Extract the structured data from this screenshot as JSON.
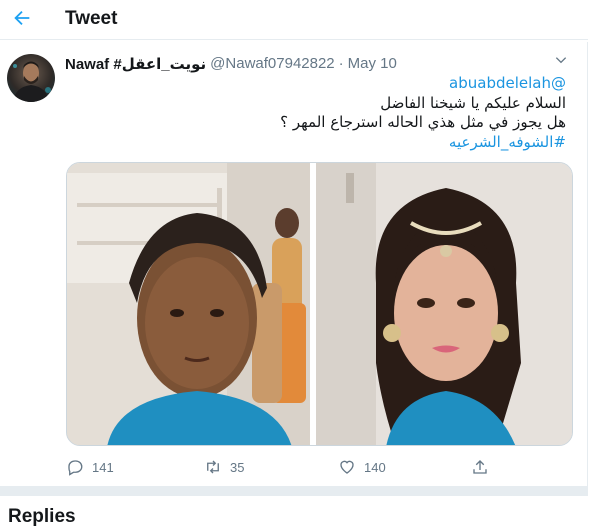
{
  "header": {
    "title": "Tweet"
  },
  "tweet": {
    "user_name": "Nawaf #نويت_اعقل",
    "handle": "@Nawaf07942822",
    "separator": "·",
    "date": "May 10",
    "mention": "@abuabdelelah",
    "line1": "السلام عليكم يا شيخنا الفاضل",
    "line2": "هل يجوز في مثل هذي الحاله استرجاع المهر ؟",
    "hashtag": "#الشوفه_الشرعيه",
    "images": [
      "photo-before",
      "photo-after"
    ]
  },
  "actions": {
    "replies": "141",
    "retweets": "35",
    "likes": "140"
  },
  "icons": {
    "back": "arrow-left-icon",
    "more": "chevron-down-icon",
    "reply": "reply-icon",
    "retweet": "retweet-icon",
    "like": "heart-icon",
    "share": "share-icon"
  },
  "colors": {
    "accent": "#1da1f2",
    "link": "#1b95e0",
    "muted": "#657786"
  },
  "replies_section": {
    "title": "Replies"
  }
}
